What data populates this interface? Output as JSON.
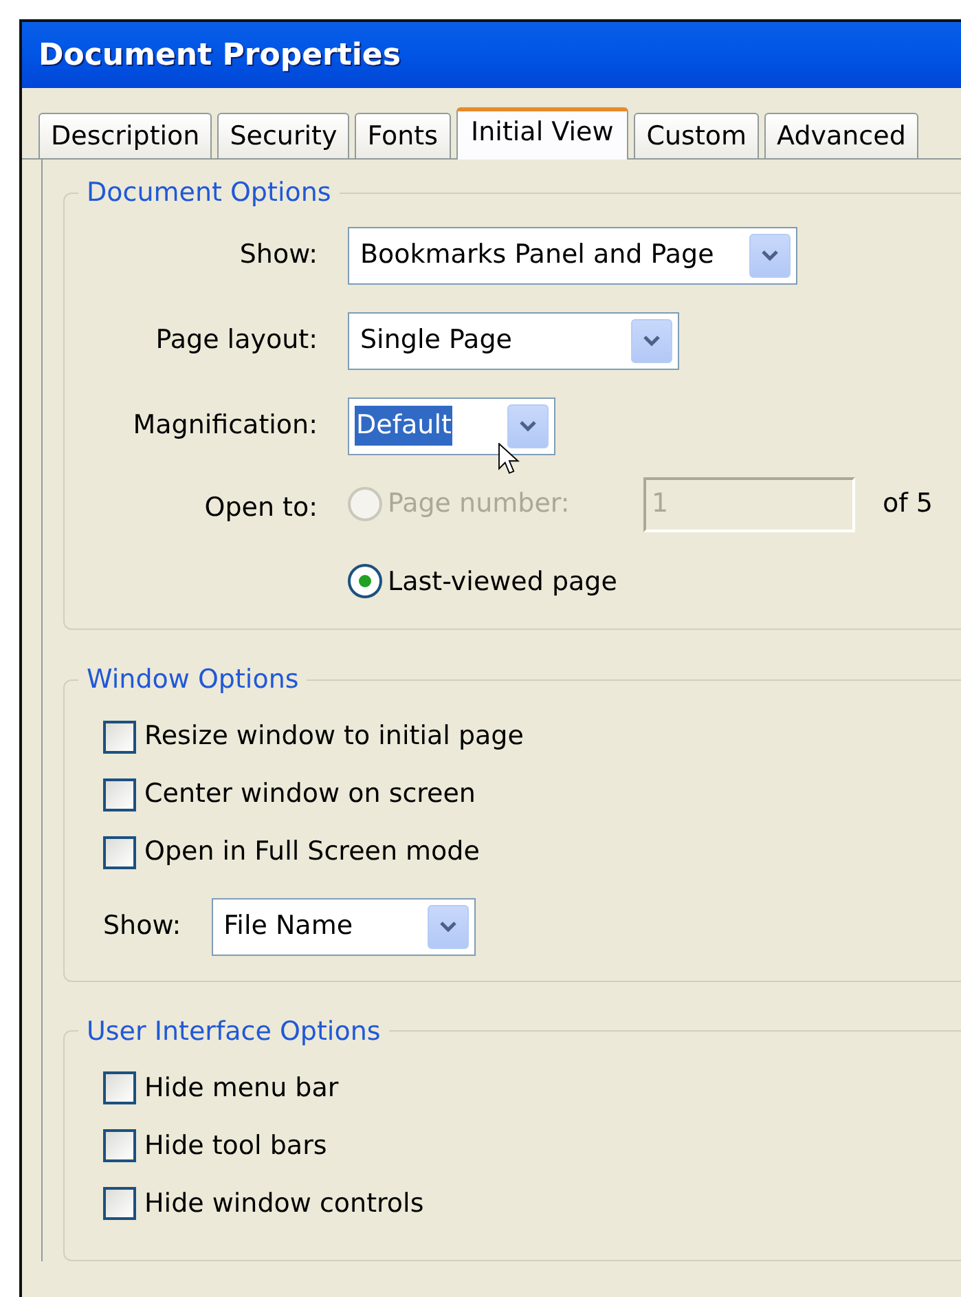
{
  "window": {
    "title": "Document Properties"
  },
  "tabs": [
    {
      "label": "Description",
      "selected": false
    },
    {
      "label": "Security",
      "selected": false
    },
    {
      "label": "Fonts",
      "selected": false
    },
    {
      "label": "Initial View",
      "selected": true
    },
    {
      "label": "Custom",
      "selected": false
    },
    {
      "label": "Advanced",
      "selected": false
    }
  ],
  "document_options": {
    "title": "Document Options",
    "fields": [
      {
        "label": "Show:",
        "value": "Bookmarks Panel and Page",
        "highlighted": false
      },
      {
        "label": "Page layout:",
        "value": "Single Page",
        "highlighted": false
      },
      {
        "label": "Magnification:",
        "value": "Default",
        "highlighted": true
      }
    ],
    "open_to": {
      "label": "Open to:",
      "options": [
        {
          "label": "Page number:",
          "selected": false,
          "disabled": true
        },
        {
          "label": "Last-viewed page",
          "selected": true,
          "disabled": false
        }
      ],
      "page_field": {
        "value": "1",
        "disabled": true
      },
      "page_count": "of 5"
    }
  },
  "window_options": {
    "title": "Window Options",
    "checkboxes": [
      {
        "label": "Resize window to initial page",
        "checked": false
      },
      {
        "label": "Center window on screen",
        "checked": false
      },
      {
        "label": "Open in Full Screen mode",
        "checked": false
      }
    ],
    "show": {
      "label": "Show:",
      "value": "File Name"
    }
  },
  "ui_options": {
    "title": "User Interface Options",
    "checkboxes": [
      {
        "label": "Hide menu bar",
        "checked": false
      },
      {
        "label": "Hide tool bars",
        "checked": false
      },
      {
        "label": "Hide window controls",
        "checked": false
      }
    ]
  }
}
